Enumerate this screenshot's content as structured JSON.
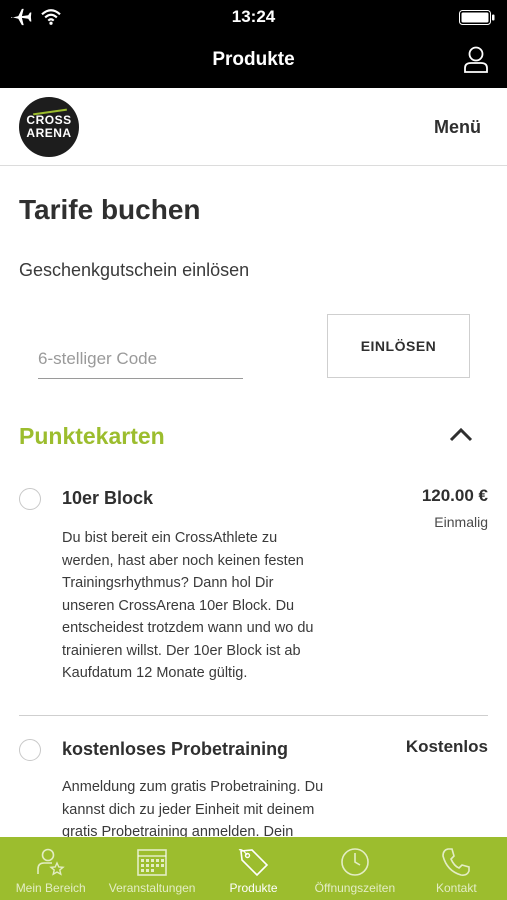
{
  "status_bar": {
    "time": "13:24",
    "icons": [
      "airplane-icon",
      "wifi-icon",
      "battery-icon"
    ]
  },
  "nav": {
    "title": "Produkte",
    "user_icon": "user-icon"
  },
  "header": {
    "logo_line1": "CROSS",
    "logo_line2": "ARENA",
    "menu_label": "Menü"
  },
  "main": {
    "title": "Tarife buchen",
    "voucher_label": "Geschenkgutschein einlösen",
    "code_placeholder": "6-stelliger Code",
    "code_value": "",
    "redeem_label": "EINLÖSEN"
  },
  "section": {
    "title": "Punktekarten",
    "collapse_icon": "chevron-up-icon",
    "products": [
      {
        "name": "10er Block",
        "price": "120.00 €",
        "frequency": "Einmalig",
        "description_lines": [
          "Du bist bereit ein CrossAthlete zu",
          "werden, hast aber noch keinen festen",
          "Trainingsrhythmus? Dann hol Dir",
          "unseren CrossArena 10er Block. Du",
          "entscheidest trotzdem wann und wo du",
          "trainieren willst. Der 10er Block ist ab",
          "Kaufdatum 12 Monate gültig."
        ]
      },
      {
        "name": "kostenloses Probetraining",
        "price": "Kostenlos",
        "frequency": "",
        "description_lines": [
          "Anmeldung zum gratis Probetraining. Du",
          "kannst dich zu jeder Einheit mit deinem",
          "gratis Probetraining anmelden. Dein"
        ]
      }
    ]
  },
  "tabbar": {
    "accent_color": "#9cbd2e",
    "tabs": [
      {
        "label": "Mein Bereich",
        "icon": "user-star-icon",
        "active": false
      },
      {
        "label": "Veranstaltungen",
        "icon": "calendar-icon",
        "active": false
      },
      {
        "label": "Produkte",
        "icon": "price-tag-icon",
        "active": true
      },
      {
        "label": "Öffnungszeiten",
        "icon": "clock-icon",
        "active": false
      },
      {
        "label": "Kontakt",
        "icon": "phone-icon",
        "active": false
      }
    ]
  }
}
